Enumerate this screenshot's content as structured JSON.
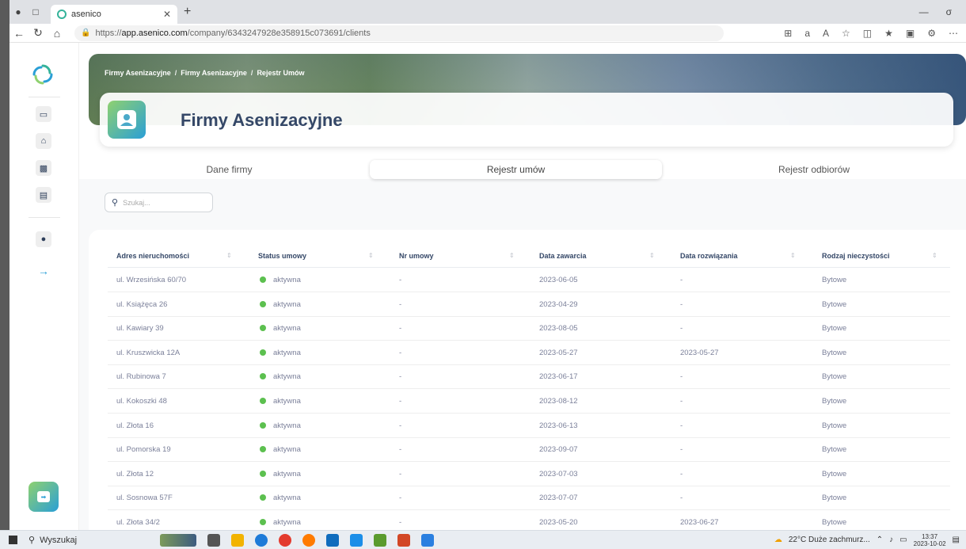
{
  "browser": {
    "tab_title": "asenico",
    "url_prefix": "https://",
    "url_host": "app.asenico.com",
    "url_path": "/company/6343247928e358915c073691/clients"
  },
  "breadcrumb": [
    "Firmy Asenizacyjne",
    "Firmy Asenizacyjne",
    "Rejestr Umów"
  ],
  "breadcrumb_sep": "/",
  "page_title": "Firmy Asenizacyjne",
  "tabs": [
    {
      "label": "Dane firmy",
      "active": false
    },
    {
      "label": "Rejestr umów",
      "active": true
    },
    {
      "label": "Rejestr odbiorów",
      "active": false
    }
  ],
  "search": {
    "placeholder": "Szukaj..."
  },
  "table": {
    "columns": [
      "Adres nieruchomości",
      "Status umowy",
      "Nr umowy",
      "Data zawarcia",
      "Data rozwiązania",
      "Rodzaj nieczystości"
    ],
    "rows": [
      [
        "ul. Wrzesińska 60/70",
        "aktywna",
        "-",
        "2023-06-05",
        "-",
        "Bytowe"
      ],
      [
        "ul. Książęca 26",
        "aktywna",
        "-",
        "2023-04-29",
        "-",
        "Bytowe"
      ],
      [
        "ul. Kawiary 39",
        "aktywna",
        "-",
        "2023-08-05",
        "-",
        "Bytowe"
      ],
      [
        "ul. Kruszwicka 12A",
        "aktywna",
        "-",
        "2023-05-27",
        "2023-05-27",
        "Bytowe"
      ],
      [
        "ul. Rubinowa 7",
        "aktywna",
        "-",
        "2023-06-17",
        "-",
        "Bytowe"
      ],
      [
        "ul. Kokoszki 48",
        "aktywna",
        "-",
        "2023-08-12",
        "-",
        "Bytowe"
      ],
      [
        "ul. Złota 16",
        "aktywna",
        "-",
        "2023-06-13",
        "-",
        "Bytowe"
      ],
      [
        "ul. Pomorska 19",
        "aktywna",
        "-",
        "2023-09-07",
        "-",
        "Bytowe"
      ],
      [
        "ul. Złota 12",
        "aktywna",
        "-",
        "2023-07-03",
        "-",
        "Bytowe"
      ],
      [
        "ul. Sosnowa 57F",
        "aktywna",
        "-",
        "2023-07-07",
        "-",
        "Bytowe"
      ],
      [
        "ul. Złota 34/2",
        "aktywna",
        "-",
        "2023-05-20",
        "2023-06-27",
        "Bytowe"
      ]
    ]
  },
  "taskbar": {
    "search_label": "Wyszukaj",
    "weather": "22°C  Duże zachmurz...",
    "time": "13:37",
    "date": "2023-10-02"
  },
  "colors": {
    "accent_green": "#5cc04f",
    "title_navy": "#344767",
    "gradient_start": "#8fd16f",
    "gradient_end": "#2a9fd6"
  }
}
